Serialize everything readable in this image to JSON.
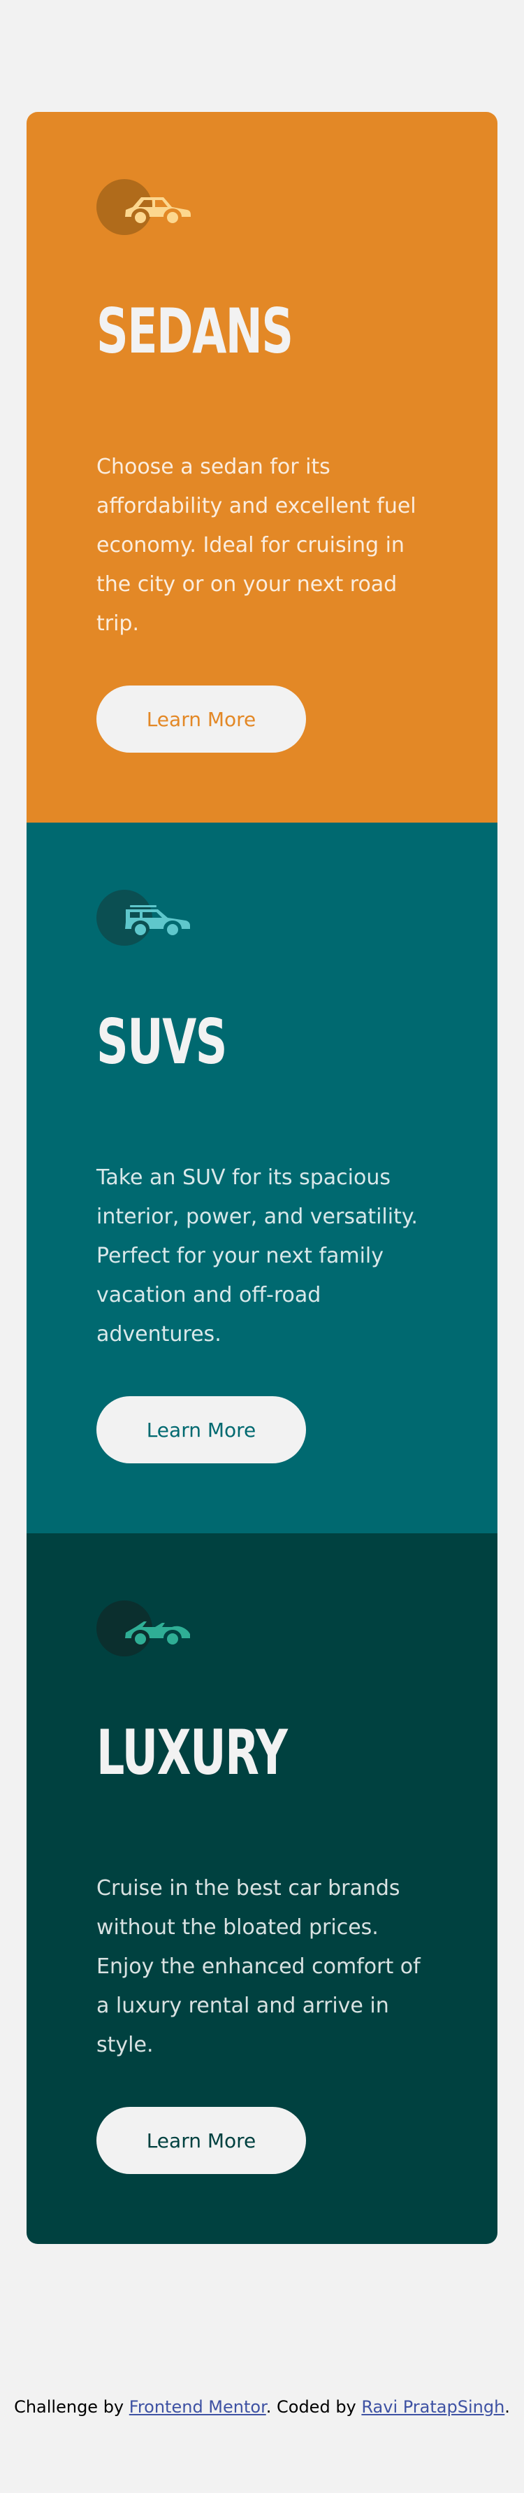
{
  "cards": [
    {
      "id": "sedans",
      "title": "SEDANS",
      "description": "Choose a sedan for its affordability and excellent fuel economy. Ideal for cruising in the city or on your next road trip.",
      "button_label": "Learn More",
      "icon": "sedan-car-icon",
      "color": "#e38826"
    },
    {
      "id": "suvs",
      "title": "SUVS",
      "description": "Take an SUV for its spacious interior, power, and versatility. Perfect for your next family vacation and off-road adventures.",
      "button_label": "Learn More",
      "icon": "suv-car-icon",
      "color": "#006970"
    },
    {
      "id": "luxury",
      "title": "LUXURY",
      "description": "Cruise in the best car brands without the bloated prices. Enjoy the enhanced comfort of a luxury rental and arrive in style.",
      "button_label": "Learn More",
      "icon": "luxury-car-icon",
      "color": "#004140"
    }
  ],
  "attribution": {
    "prefix": "Challenge by ",
    "link1_text": "Frontend Mentor",
    "middle": ". Coded by ",
    "link2_text": "Ravi PratapSingh",
    "suffix": "."
  },
  "colors": {
    "background": "#f2f2f2",
    "link": "#3e52a3"
  }
}
